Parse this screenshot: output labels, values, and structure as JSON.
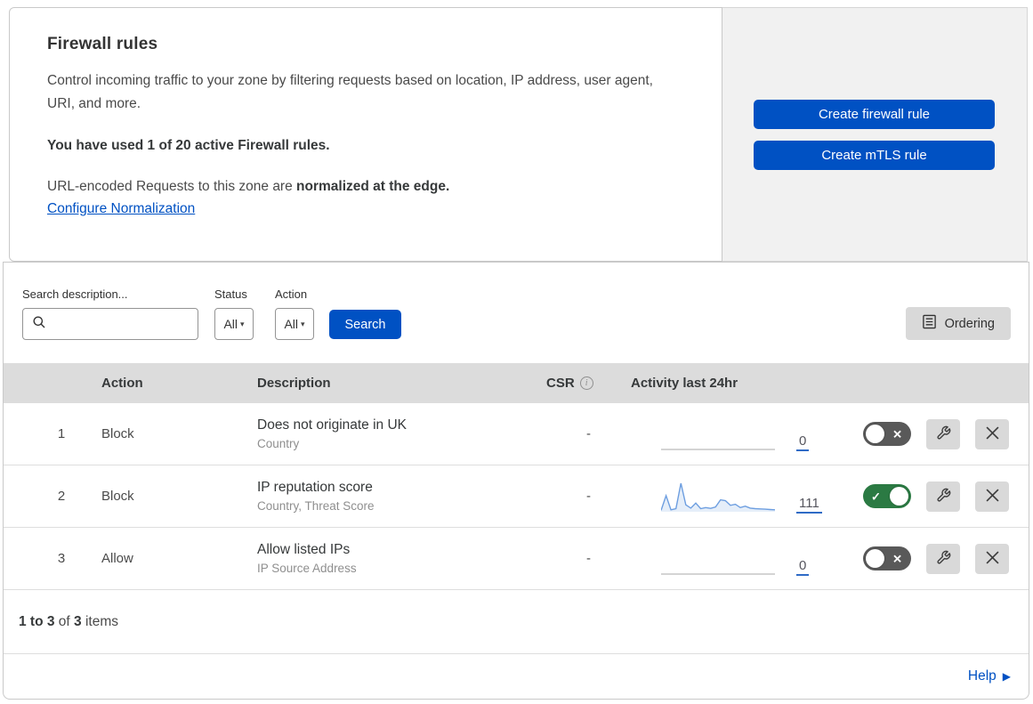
{
  "theme": {
    "accent_blue": "#0051c3",
    "toggle_green": "#2b7a43",
    "toggle_gray": "#595959",
    "spark_blue": "#6d9ee0",
    "header_bg": "#dcdcdc",
    "panel_bg": "#f1f1f1"
  },
  "intro": {
    "title": "Firewall rules",
    "description": "Control incoming traffic to your zone by filtering requests based on location, IP address, user agent, URI, and more.",
    "usage": "You have used 1 of 20 active Firewall rules.",
    "normalization_prefix": "URL-encoded Requests to this zone are ",
    "normalization_bold": "normalized at the edge.",
    "normalization_link": "Configure Normalization"
  },
  "cta": {
    "create_firewall_rule": "Create firewall rule",
    "create_mtls_rule": "Create mTLS rule"
  },
  "toolbar": {
    "search_label": "Search description...",
    "search_placeholder": "",
    "status_label": "Status",
    "status_value": "All",
    "action_label": "Action",
    "action_value": "All",
    "search_button": "Search",
    "ordering_button": "Ordering"
  },
  "icons": {
    "caret": "▾",
    "check": "✓",
    "cross": "✕",
    "info": "i",
    "help_arrow": "▶"
  },
  "table": {
    "headers": {
      "action": "Action",
      "description": "Description",
      "csr": "CSR",
      "activity": "Activity last 24hr"
    },
    "rows": [
      {
        "priority": "1",
        "action": "Block",
        "title": "Does not originate in UK",
        "subtitle": "Country",
        "csr": "-",
        "count": "0",
        "enabled": false,
        "activity_sparkline": [
          0,
          0,
          0,
          0,
          0,
          0,
          0,
          0,
          0,
          0,
          0,
          0,
          0,
          0,
          0,
          0,
          0,
          0,
          0,
          0,
          0,
          0,
          0,
          0
        ]
      },
      {
        "priority": "2",
        "action": "Block",
        "title": "IP reputation score",
        "subtitle": "Country, Threat Score",
        "csr": "-",
        "count": "111",
        "enabled": true,
        "activity_sparkline": [
          2,
          55,
          4,
          8,
          100,
          22,
          10,
          28,
          8,
          12,
          9,
          14,
          40,
          37,
          20,
          24,
          12,
          17,
          10,
          8,
          7,
          6,
          5,
          4
        ]
      },
      {
        "priority": "3",
        "action": "Allow",
        "title": "Allow listed IPs",
        "subtitle": "IP Source Address",
        "csr": "-",
        "count": "0",
        "enabled": false,
        "activity_sparkline": [
          0,
          0,
          0,
          0,
          0,
          0,
          0,
          0,
          0,
          0,
          0,
          0,
          0,
          0,
          0,
          0,
          0,
          0,
          0,
          0,
          0,
          0,
          0,
          0
        ]
      }
    ]
  },
  "footer": {
    "range": "1 to 3",
    "of": "of",
    "total": "3",
    "items": "items"
  },
  "help": {
    "label": "Help"
  }
}
